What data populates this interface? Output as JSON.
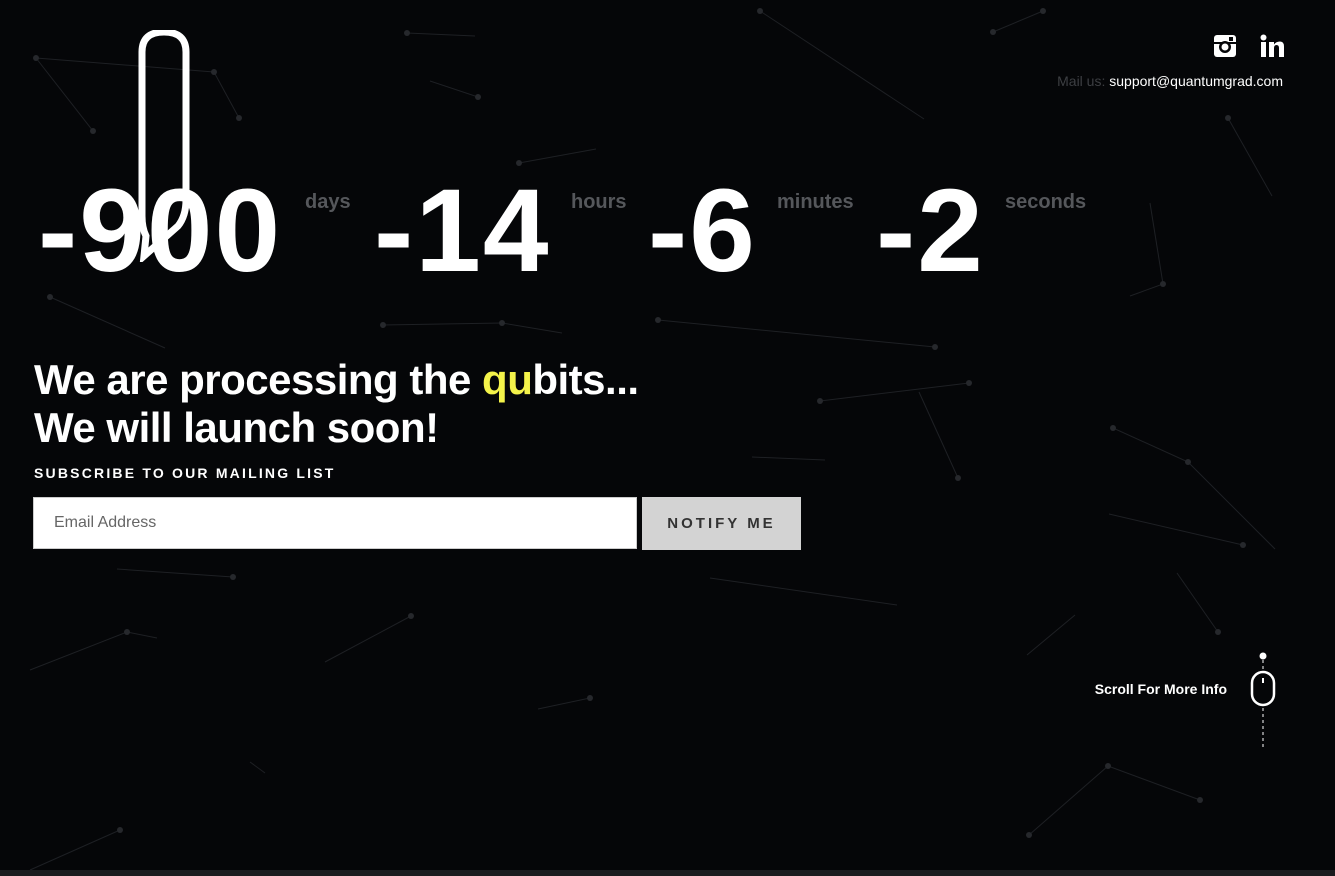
{
  "header": {
    "social": [
      {
        "icon": "instagram-icon"
      },
      {
        "icon": "linkedin-icon"
      }
    ],
    "mail_label": "Mail us:",
    "mail_address": "support@quantumgrad.com"
  },
  "countdown": [
    {
      "value": "-900",
      "unit": "days"
    },
    {
      "value": "-14",
      "unit": "hours"
    },
    {
      "value": "-6",
      "unit": "minutes"
    },
    {
      "value": "-2",
      "unit": "seconds"
    }
  ],
  "headline": {
    "line1_pre": "We are processing the ",
    "line1_highlight": "qu",
    "line1_post": "bits...",
    "line2": "We will launch soon!"
  },
  "subscribe": {
    "title": "SUBSCRIBE TO OUR MAILING LIST",
    "email_placeholder": "Email Address",
    "button": "NOTIFY ME"
  },
  "scroll": {
    "label": "Scroll For More Info"
  },
  "colors": {
    "background": "#050608",
    "highlight": "#f4f34a",
    "unit_text": "#55575b"
  }
}
